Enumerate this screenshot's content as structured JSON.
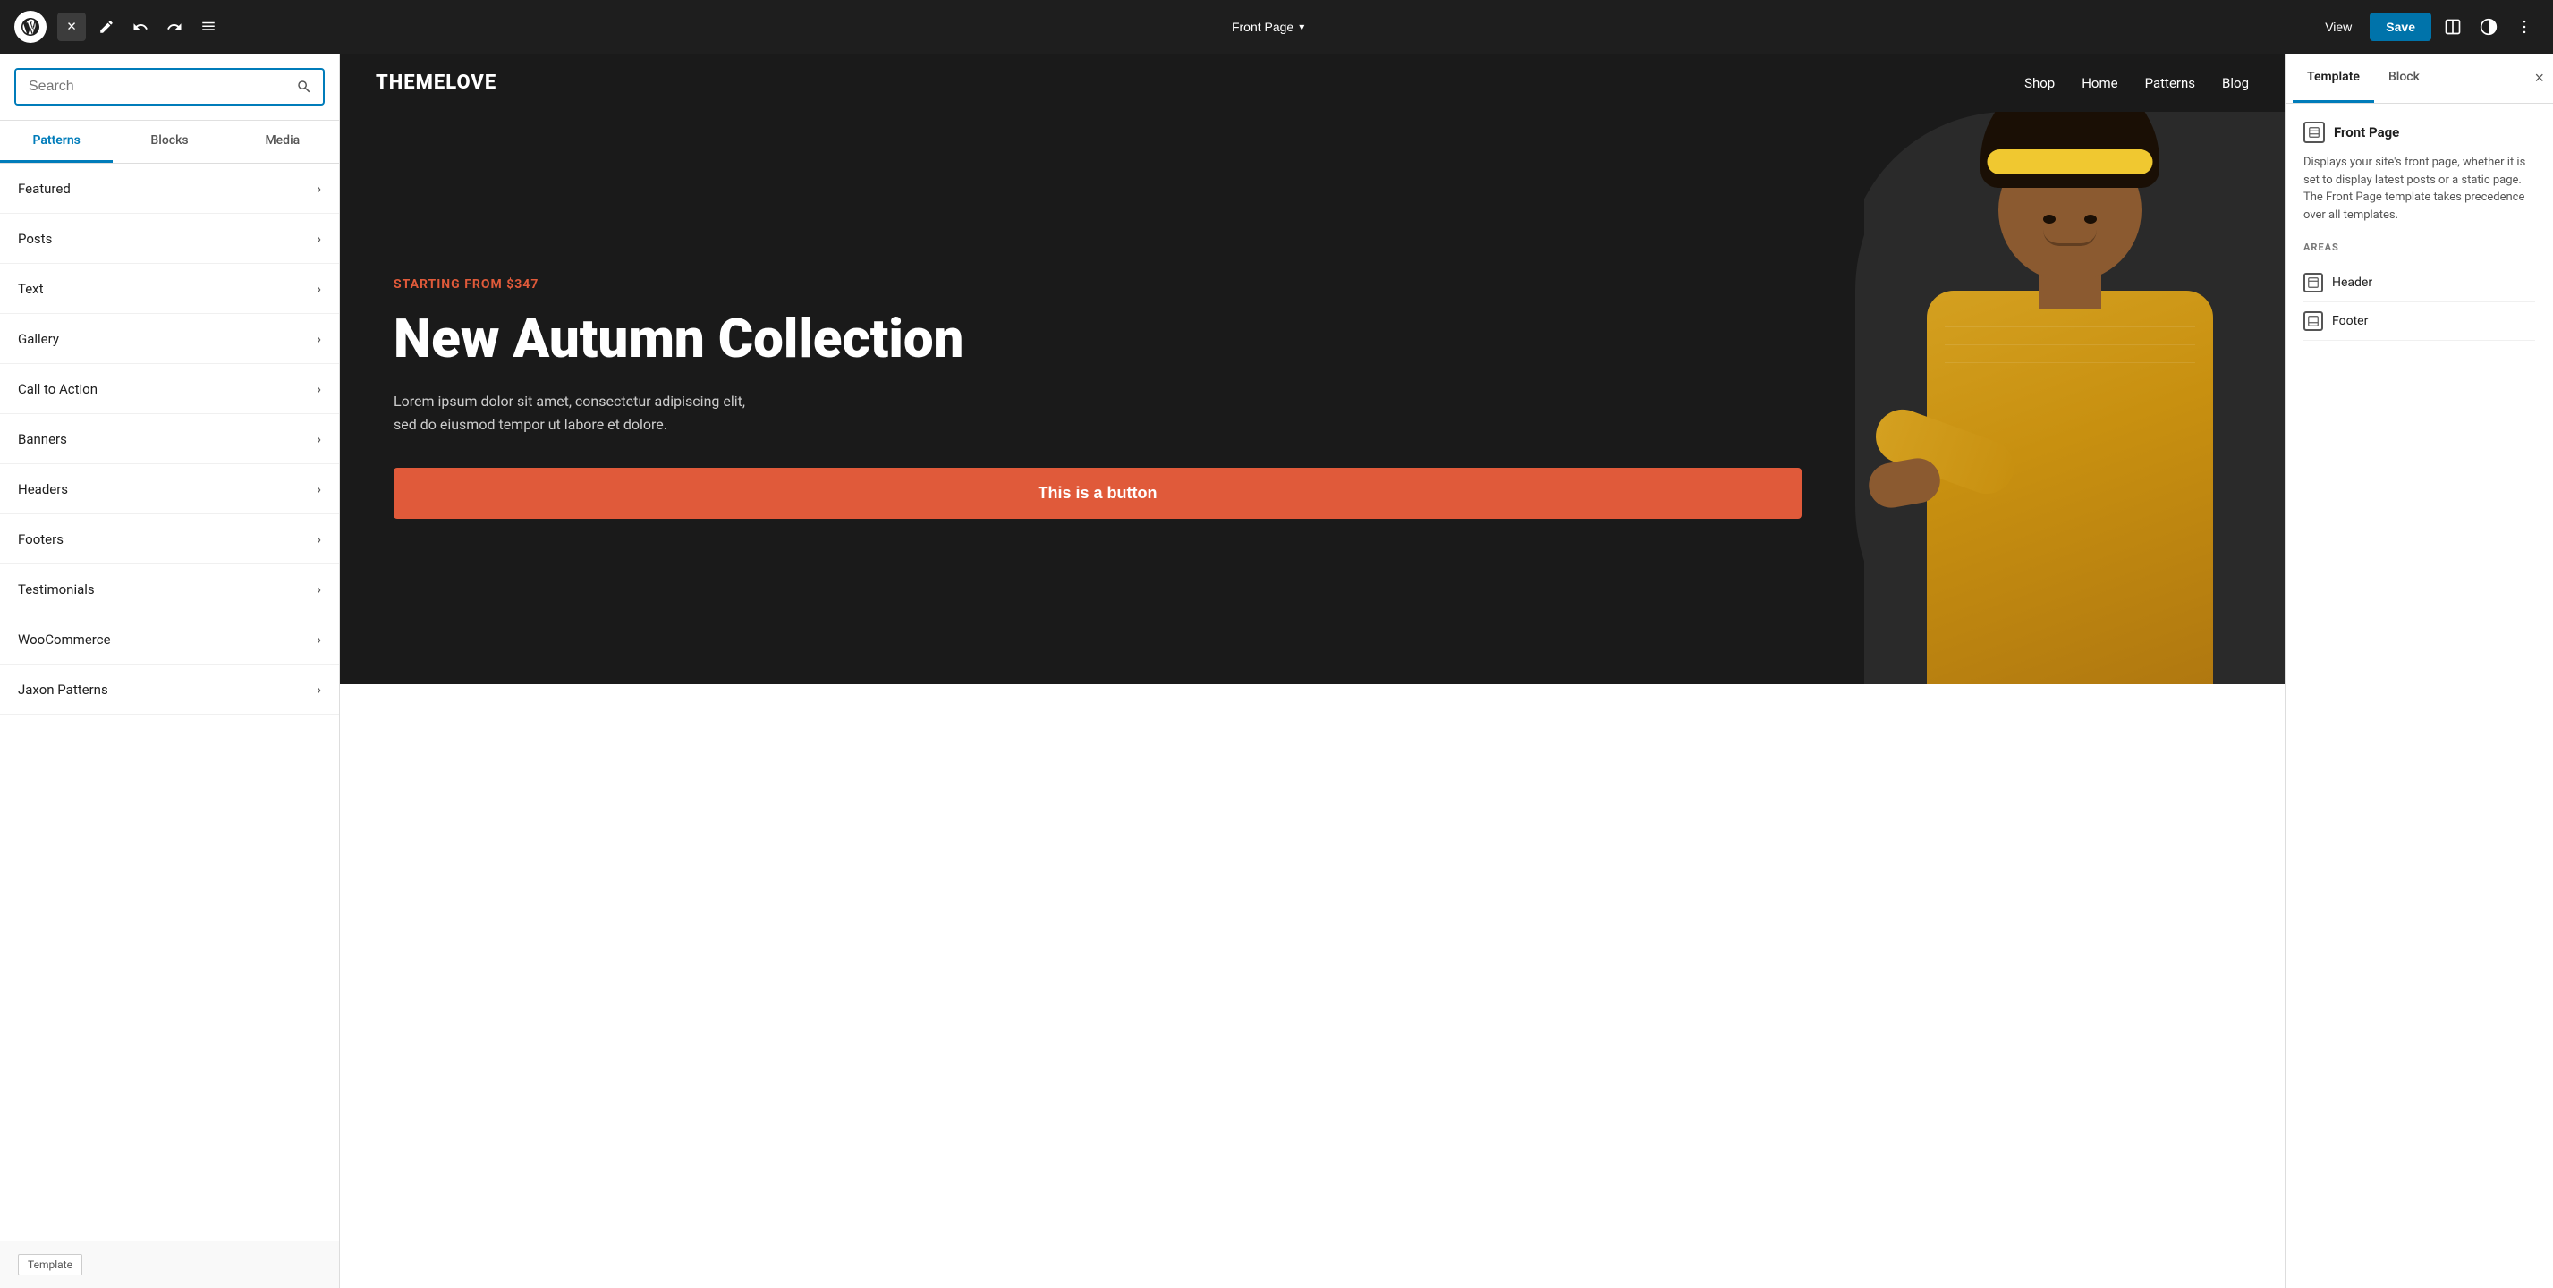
{
  "toolbar": {
    "page_title": "Front Page",
    "view_label": "View",
    "save_label": "Save",
    "close_icon": "✕",
    "edit_icon": "✏",
    "undo_icon": "↩",
    "redo_icon": "↪",
    "list_icon": "≡",
    "chevron_down": "▾",
    "more_icon": "⋮",
    "half_circle_icon": "◑"
  },
  "left_sidebar": {
    "search_placeholder": "Search",
    "tabs": [
      {
        "id": "patterns",
        "label": "Patterns",
        "active": true
      },
      {
        "id": "blocks",
        "label": "Blocks",
        "active": false
      },
      {
        "id": "media",
        "label": "Media",
        "active": false
      }
    ],
    "pattern_categories": [
      {
        "id": "featured",
        "label": "Featured"
      },
      {
        "id": "posts",
        "label": "Posts"
      },
      {
        "id": "text",
        "label": "Text"
      },
      {
        "id": "gallery",
        "label": "Gallery"
      },
      {
        "id": "call-to-action",
        "label": "Call to Action"
      },
      {
        "id": "banners",
        "label": "Banners"
      },
      {
        "id": "headers",
        "label": "Headers"
      },
      {
        "id": "footers",
        "label": "Footers"
      },
      {
        "id": "testimonials",
        "label": "Testimonials"
      },
      {
        "id": "woocommerce",
        "label": "WooCommerce"
      },
      {
        "id": "jaxon-patterns",
        "label": "Jaxon Patterns"
      }
    ],
    "bottom_label": "Template"
  },
  "canvas": {
    "site_logo": "THEMELOVE",
    "nav_items": [
      "Shop",
      "Home",
      "Patterns",
      "Blog"
    ],
    "hero_tag": "STARTING FROM $347",
    "hero_title": "New Autumn Collection",
    "hero_description": "Lorem ipsum dolor sit amet, consectetur adipiscing elit, sed do eiusmod tempor ut labore et dolore.",
    "hero_button": "This is a button"
  },
  "right_panel": {
    "tabs": [
      {
        "id": "template",
        "label": "Template",
        "active": true
      },
      {
        "id": "block",
        "label": "Block",
        "active": false
      }
    ],
    "close_label": "×",
    "template_title": "Front Page",
    "template_description": "Displays your site's front page, whether it is set to display latest posts or a static page. The Front Page template takes precedence over all templates.",
    "areas_label": "AREAS",
    "areas": [
      {
        "id": "header",
        "label": "Header"
      },
      {
        "id": "footer",
        "label": "Footer"
      }
    ]
  }
}
